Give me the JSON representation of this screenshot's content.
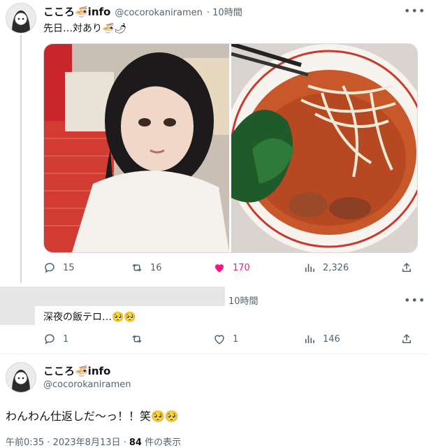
{
  "tweet1": {
    "display_name": "こころ🍜info",
    "handle": "@cocorokaniramen",
    "time": "· 10時間",
    "text": "先日…対あり🍜🌶",
    "photo_left": "selfie",
    "photo_right": "ramen",
    "actions": {
      "replies": "15",
      "retweets": "16",
      "likes": "170",
      "views": "2,326"
    }
  },
  "tweet2": {
    "time": "10時間",
    "text": "深夜の飯テロ…🥺🥺",
    "actions": {
      "replies": "1",
      "likes": "1",
      "views": "146"
    }
  },
  "tweet3": {
    "display_name": "こころ🍜info",
    "handle": "@cocorokaniramen",
    "text": "わんわん仕返しだ〜っ！！笑🥺🥺",
    "meta_time": "午前0:35 · 2023年8月13日 · ",
    "meta_views": "84",
    "meta_views_suffix": " 件の表示"
  },
  "colors": {
    "like_pink": "#f91880",
    "muted": "#536471",
    "border": "#cfd9de"
  },
  "icons": [
    "reply-icon",
    "retweet-icon",
    "like-icon",
    "views-icon",
    "share-icon",
    "more-icon"
  ]
}
